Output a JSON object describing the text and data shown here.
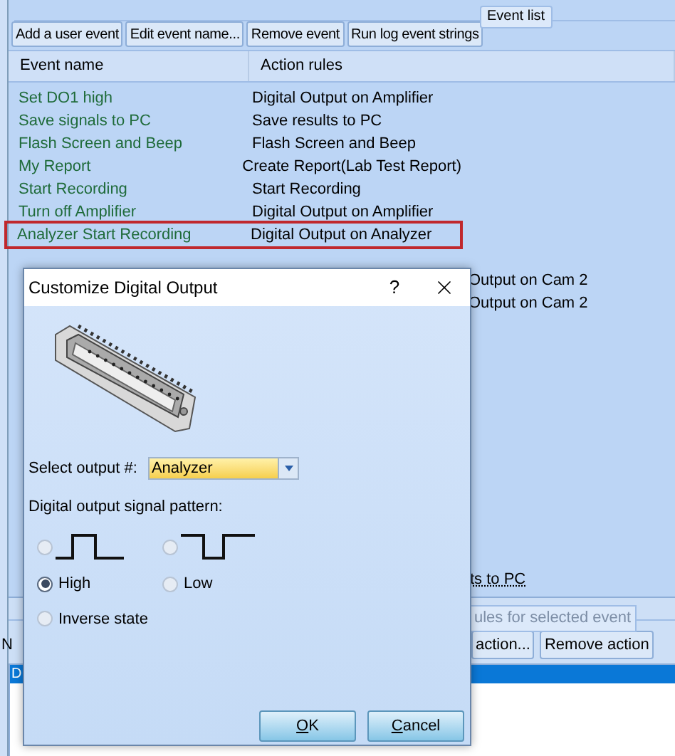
{
  "event_list": {
    "title": "Event list",
    "buttons": [
      "Add a user event",
      "Edit event name...",
      "Remove event",
      "Run log event strings"
    ],
    "columns": [
      "Event name",
      "Action rules"
    ],
    "rows": [
      {
        "name": "Set DO1 high",
        "action": "Digital Output on Amplifier",
        "selected": false
      },
      {
        "name": "Save signals to PC",
        "action": "Save results to PC",
        "selected": false
      },
      {
        "name": "Flash Screen and Beep",
        "action": "Flash Screen and Beep",
        "selected": false
      },
      {
        "name": "My Report",
        "action": "Create Report(Lab Test Report)",
        "selected": false
      },
      {
        "name": "Start Recording",
        "action": "Start Recording",
        "selected": false
      },
      {
        "name": "Turn off Amplifier",
        "action": "Digital Output on Amplifier",
        "selected": false
      },
      {
        "name": "Analyzer Start Recording",
        "action": "Digital Output on Analyzer",
        "selected": true
      }
    ],
    "covered_rows": [
      "Output on Cam 2",
      "Output on Cam 2"
    ],
    "last_row_fragment": "ts to PC"
  },
  "rules_panel": {
    "group_title": "ules for selected event",
    "column_fragment": "N",
    "buttons": [
      "action...",
      "Remove action"
    ],
    "row_fragment": "D",
    "row_selected": true
  },
  "dialog": {
    "title": "Customize Digital Output",
    "help": "?",
    "select_label": "Select output #:",
    "select_value": "Analyzer",
    "pattern_label": "Digital output signal pattern:",
    "patterns": [
      {
        "kind": "pulse-high",
        "selected": false
      },
      {
        "kind": "pulse-low",
        "selected": false
      }
    ],
    "states": [
      {
        "label": "High",
        "selected": true
      },
      {
        "label": "Low",
        "selected": false
      },
      {
        "label": "Inverse state",
        "selected": false
      }
    ],
    "buttons": [
      "OK",
      "Cancel"
    ]
  }
}
